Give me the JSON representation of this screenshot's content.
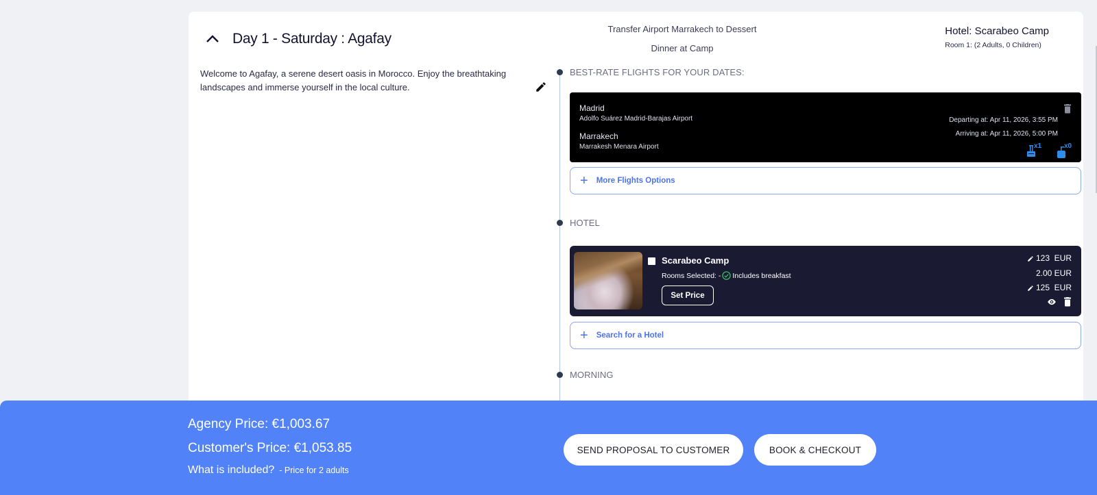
{
  "day": {
    "title": "Day 1 - Saturday : Agafay",
    "description": "Welcome to Agafay, a serene desert oasis in Morocco. Enjoy the breathtaking landscapes and immerse yourself in the local culture.",
    "activities": [
      "Transfer Airport Marrakech to Dessert",
      "Dinner at Camp"
    ],
    "hotel_heading": "Hotel: Scarabeo Camp",
    "room_info": "Room 1: (2 Adults, 0 Children)"
  },
  "sections": {
    "flights": "BEST-RATE FLIGHTS FOR YOUR DATES:",
    "hotel": "HOTEL",
    "morning": "MORNING"
  },
  "flight": {
    "origin_city": "Madrid",
    "origin_airport": "Adolfo Suárez Madrid-Barajas Airport",
    "destination_city": "Marrakech",
    "destination_airport": "Marrakesh Menara Airport",
    "departing": "Departing at: Apr 11, 2026, 3:55 PM",
    "arriving": "Arriving at: Apr 11, 2026, 5:00 PM",
    "cabin_bag_count": "x1",
    "checked_bag_count": "x0",
    "more_options_label": "More Flights Options"
  },
  "hotel": {
    "name": "Scarabeo Camp",
    "rooms_selected": "Rooms Selected: -",
    "breakfast": "Includes breakfast",
    "set_price_label": "Set Price",
    "price_base": "123  EUR",
    "price_extra": "2.00 EUR",
    "price_total": "125  EUR",
    "search_label": "Search for a Hotel"
  },
  "footer": {
    "agency_price": "Agency Price: €1,003.67",
    "customer_price": "Customer's Price: €1,053.85",
    "included_label": "What is included?",
    "price_note": "- Price for 2 adults",
    "send_proposal_label": "SEND PROPOSAL TO CUSTOMER",
    "book_label": "BOOK & CHECKOUT"
  },
  "colors": {
    "accent": "#5282f7",
    "link": "#4d73e8",
    "hotel_card_bg": "#1b1a33",
    "flight_card_bg": "#000000",
    "baggage": "#2d8cf0",
    "breakfast_check": "#3cc46a"
  }
}
